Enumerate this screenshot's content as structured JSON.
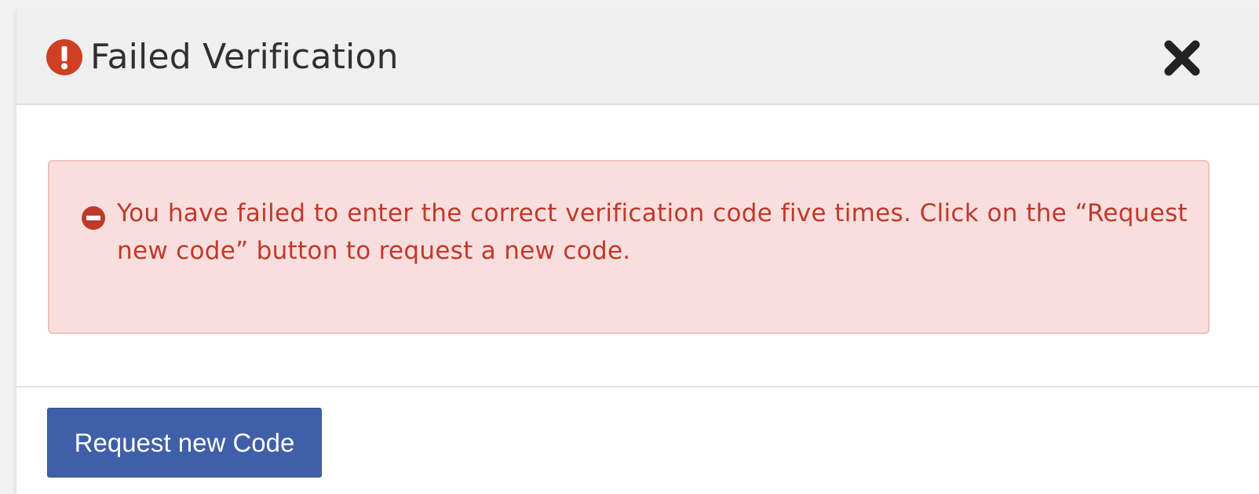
{
  "dialog": {
    "title": "Failed Verification",
    "title_icon": "exclamation-circle-icon",
    "close_icon": "close-x-icon"
  },
  "alert": {
    "icon": "minus-circle-icon",
    "message": "You have failed to enter the correct verification code five times.  Click on the “Request new code” button to request a new code."
  },
  "footer": {
    "request_button_label": "Request new Code"
  },
  "colors": {
    "title_icon": "#cf3f24",
    "alert_background": "#f8dedd",
    "alert_border": "#f1bfbd",
    "alert_text": "#c0392b",
    "button_background": "#3f5fa8",
    "header_background": "#efefef"
  }
}
